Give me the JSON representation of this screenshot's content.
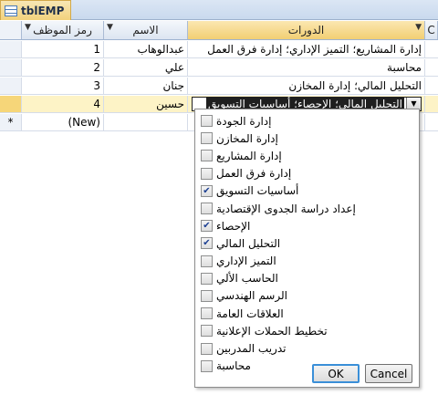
{
  "tab": {
    "title": "tblEMP"
  },
  "grid": {
    "headers": {
      "id": "رمز الموظف",
      "name": "الاسم",
      "course": "الدورات",
      "extra": "C"
    },
    "rows": [
      {
        "id": "1",
        "name": "عبدالوهاب",
        "course": "إدارة المشاريع؛ التميز الإداري؛ إدارة فرق العمل"
      },
      {
        "id": "2",
        "name": "علي",
        "course": "محاسبة"
      },
      {
        "id": "3",
        "name": "جنان",
        "course": "التحليل المالي؛ إدارة المخازن"
      },
      {
        "id": "4",
        "name": "حسين",
        "course": "التحليل المالي؛ الإحصاء؛ أساسيات التسويق"
      }
    ],
    "new_row": {
      "selector": "*",
      "id": "(New)"
    },
    "current_row_indicator": "✎"
  },
  "dropdown": {
    "items": [
      {
        "label": "إدارة الجودة",
        "checked": false
      },
      {
        "label": "إدارة المخازن",
        "checked": false
      },
      {
        "label": "إدارة المشاريع",
        "checked": false
      },
      {
        "label": "إدارة فرق العمل",
        "checked": false
      },
      {
        "label": "أساسيات التسويق",
        "checked": true
      },
      {
        "label": "إعداد دراسة الجدوى الإقتصادية",
        "checked": false
      },
      {
        "label": "الإحصاء",
        "checked": true
      },
      {
        "label": "التحليل المالي",
        "checked": true
      },
      {
        "label": "التميز الإداري",
        "checked": false
      },
      {
        "label": "الحاسب الألي",
        "checked": false
      },
      {
        "label": "الرسم الهندسي",
        "checked": false
      },
      {
        "label": "العلاقات العامة",
        "checked": false
      },
      {
        "label": "تخطيط الحملات الإعلانية",
        "checked": false
      },
      {
        "label": "تدريب المدربين",
        "checked": false
      },
      {
        "label": "محاسبة",
        "checked": false
      }
    ],
    "ok_label": "OK",
    "cancel_label": "Cancel"
  },
  "colors": {
    "accent": "#f2d27c",
    "selection": "#1f1f1f",
    "focus_border": "#3a8fd8"
  }
}
